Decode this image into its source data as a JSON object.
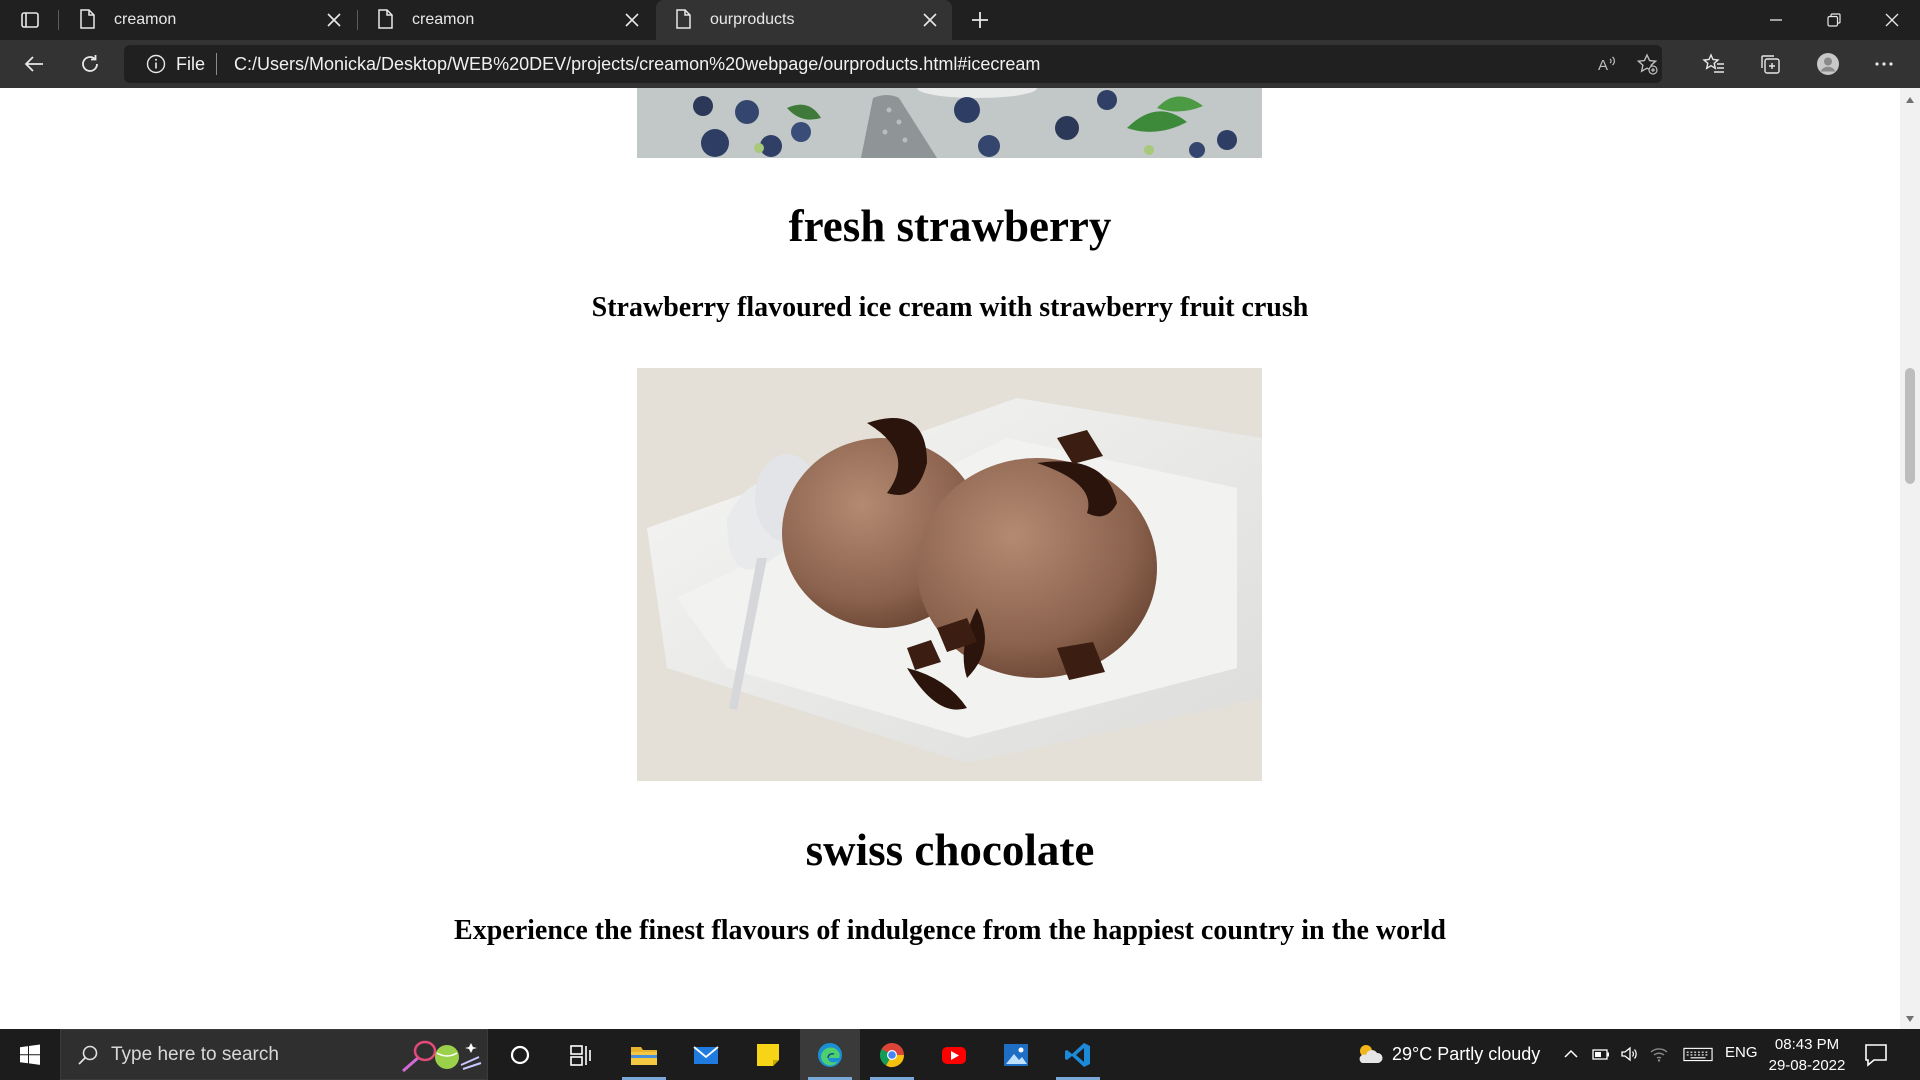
{
  "browser": {
    "tabs": [
      {
        "title": "creamon",
        "active": false
      },
      {
        "title": "creamon",
        "active": false
      },
      {
        "title": "ourproducts",
        "active": true
      }
    ],
    "address": {
      "scheme_label": "File",
      "url": "C:/Users/Monicka/Desktop/WEB%20DEV/projects/creamon%20webpage/ourproducts.html#icecream"
    }
  },
  "page": {
    "products": [
      {
        "title": "fresh strawberry",
        "description": "Strawberry flavoured ice cream with strawberry fruit crush"
      },
      {
        "title": "swiss chocolate",
        "description": "Experience the finest flavours of indulgence from the happiest country in the world"
      }
    ]
  },
  "taskbar": {
    "search_placeholder": "Type here to search",
    "weather": "29°C  Partly cloudy",
    "language": "ENG",
    "time": "08:43 PM",
    "date": "29-08-2022",
    "pinned_apps": [
      "file-explorer",
      "mail",
      "sticky-notes",
      "edge",
      "chrome",
      "youtube",
      "photos",
      "vscode"
    ]
  },
  "colors": {
    "titlebar": "#202020",
    "toolbar": "#333333",
    "taskbar": "#1c1c1c",
    "page_bg": "#ffffff"
  }
}
